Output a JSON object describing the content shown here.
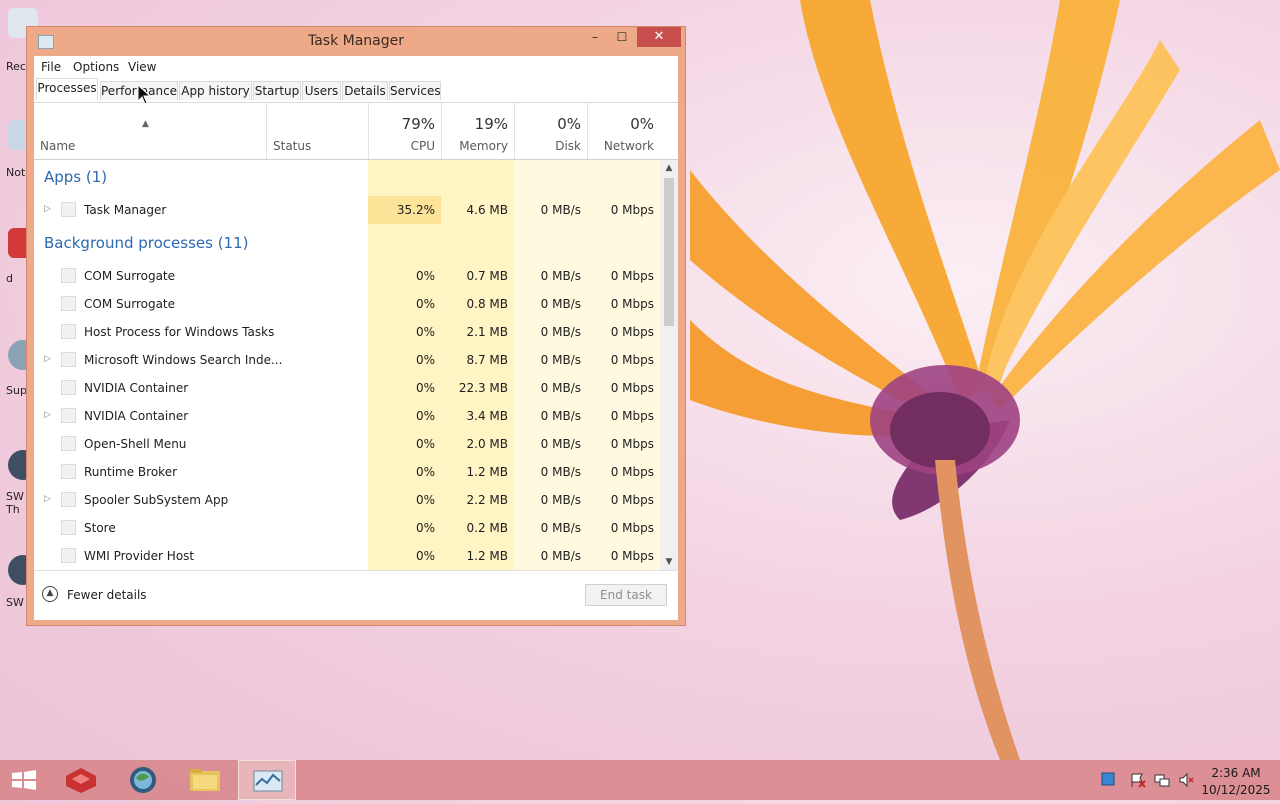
{
  "window": {
    "title": "Task Manager",
    "controls": {
      "minimize": "–",
      "maximize": "☐",
      "close": "✕"
    }
  },
  "menu": [
    "File",
    "Options",
    "View"
  ],
  "tabs": [
    "Processes",
    "Performance",
    "App history",
    "Startup",
    "Users",
    "Details",
    "Services"
  ],
  "active_tab": "Processes",
  "columns": {
    "name": "Name",
    "status": "Status",
    "cpu": {
      "pct": "79%",
      "label": "CPU"
    },
    "memory": {
      "pct": "19%",
      "label": "Memory"
    },
    "disk": {
      "pct": "0%",
      "label": "Disk"
    },
    "network": {
      "pct": "0%",
      "label": "Network"
    }
  },
  "groups": {
    "apps": {
      "title": "Apps (1)"
    },
    "background": {
      "title": "Background processes (11)"
    }
  },
  "apps": [
    {
      "name": "Task Manager",
      "cpu": "35.2%",
      "memory": "4.6 MB",
      "disk": "0 MB/s",
      "network": "0 Mbps",
      "expandable": true
    }
  ],
  "background": [
    {
      "name": "COM Surrogate",
      "cpu": "0%",
      "memory": "0.7 MB",
      "disk": "0 MB/s",
      "network": "0 Mbps",
      "expandable": false
    },
    {
      "name": "COM Surrogate",
      "cpu": "0%",
      "memory": "0.8 MB",
      "disk": "0 MB/s",
      "network": "0 Mbps",
      "expandable": false
    },
    {
      "name": "Host Process for Windows Tasks",
      "cpu": "0%",
      "memory": "2.1 MB",
      "disk": "0 MB/s",
      "network": "0 Mbps",
      "expandable": false
    },
    {
      "name": "Microsoft Windows Search Inde...",
      "cpu": "0%",
      "memory": "8.7 MB",
      "disk": "0 MB/s",
      "network": "0 Mbps",
      "expandable": true
    },
    {
      "name": "NVIDIA Container",
      "cpu": "0%",
      "memory": "22.3 MB",
      "disk": "0 MB/s",
      "network": "0 Mbps",
      "expandable": false
    },
    {
      "name": "NVIDIA Container",
      "cpu": "0%",
      "memory": "3.4 MB",
      "disk": "0 MB/s",
      "network": "0 Mbps",
      "expandable": true
    },
    {
      "name": "Open-Shell Menu",
      "cpu": "0%",
      "memory": "2.0 MB",
      "disk": "0 MB/s",
      "network": "0 Mbps",
      "expandable": false
    },
    {
      "name": "Runtime Broker",
      "cpu": "0%",
      "memory": "1.2 MB",
      "disk": "0 MB/s",
      "network": "0 Mbps",
      "expandable": false
    },
    {
      "name": "Spooler SubSystem App",
      "cpu": "0%",
      "memory": "2.2 MB",
      "disk": "0 MB/s",
      "network": "0 Mbps",
      "expandable": true
    },
    {
      "name": "Store",
      "cpu": "0%",
      "memory": "0.2 MB",
      "disk": "0 MB/s",
      "network": "0 Mbps",
      "expandable": false
    },
    {
      "name": "WMI Provider Host",
      "cpu": "0%",
      "memory": "1.2 MB",
      "disk": "0 MB/s",
      "network": "0 Mbps",
      "expandable": false
    }
  ],
  "footer": {
    "fewer_details": "Fewer details",
    "end_task": "End task"
  },
  "desktop_icons": [
    "Rec",
    "Not",
    "d",
    "Sup",
    "SW Th",
    "SW"
  ],
  "taskbar": {
    "apps": [
      "start-icon",
      "app-red-cube-icon",
      "browser-globe-icon",
      "file-explorer-icon",
      "task-manager-icon"
    ],
    "clock_time": "2:36 AM",
    "clock_date": "10/12/2025"
  },
  "colors": {
    "window_frame": "#eea988",
    "cpu_high": "#fce398",
    "cpu_low": "#fff4c4",
    "group_title": "#2b6ab0"
  }
}
